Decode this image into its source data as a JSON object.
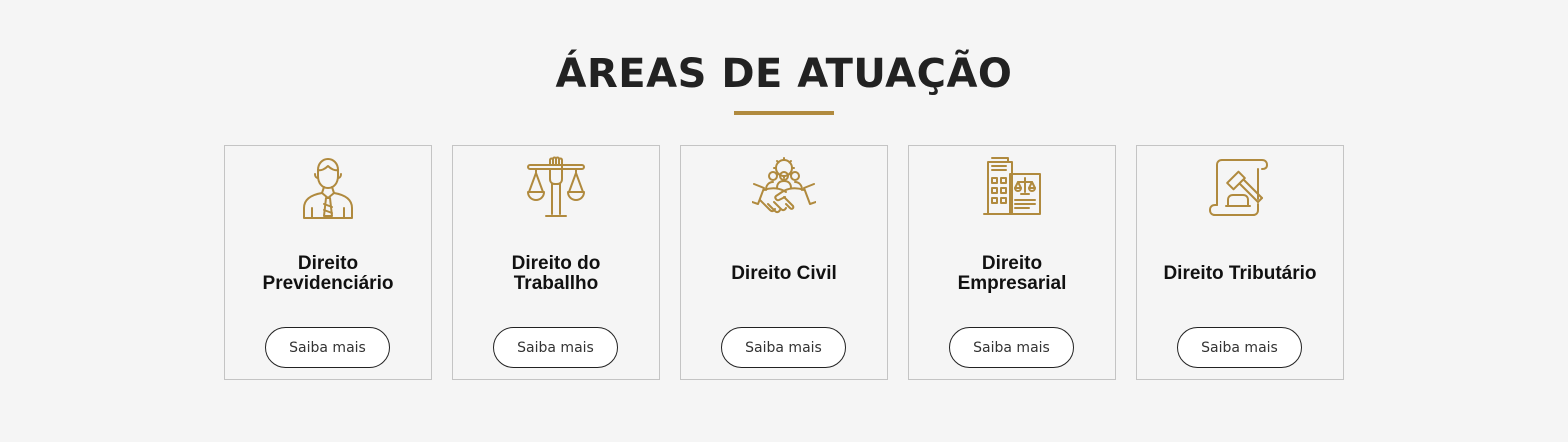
{
  "section": {
    "title": "ÁREAS DE ATUAÇÃO",
    "accent_color": "#b08a3e"
  },
  "cards": [
    {
      "title": "Direito\nPrevidenciário",
      "icon": "businessman-icon",
      "button_label": "Saiba mais"
    },
    {
      "title": "Direito do\nTraballho",
      "icon": "scales-fist-icon",
      "button_label": "Saiba mais"
    },
    {
      "title": "Direito Civil",
      "icon": "community-handshake-icon",
      "button_label": "Saiba mais"
    },
    {
      "title": "Direito\nEmpresarial",
      "icon": "building-scales-icon",
      "button_label": "Saiba mais"
    },
    {
      "title": "Direito Tributário",
      "icon": "gavel-document-icon",
      "button_label": "Saiba mais"
    }
  ]
}
